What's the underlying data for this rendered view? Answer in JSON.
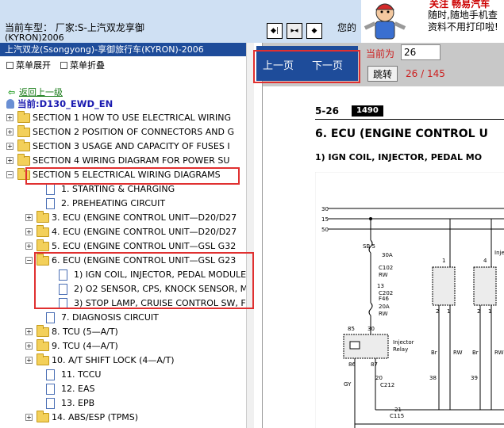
{
  "header": {
    "current_car_label": "当前车型：",
    "current_car_value": "厂家:S-上汽双龙享御",
    "current_car_model": "(KYRON)2006",
    "doc_hint": "您的",
    "ad": {
      "line1": "关注  畅易汽车",
      "line2": "随时,随地手机查",
      "line3": "资料不用打印啦!"
    },
    "nav_icons": [
      "first-page-icon",
      "fit-page-icon",
      "prev-frame-icon"
    ]
  },
  "left_panel": {
    "title": "上汽双龙(Ssongyong)-享御旅行车(KYRON)-2006",
    "expand_all": "菜单展开",
    "collapse_all": "菜单折叠",
    "back_link": "返回上一级",
    "current": "当前:D130_EWD_EN",
    "tree": [
      {
        "label": "SECTION 1 HOW TO USE ELECTRICAL WIRING",
        "type": "folder",
        "toggle": "+",
        "indent": 0
      },
      {
        "label": "SECTION 2 POSITION OF CONNECTORS AND G",
        "type": "folder",
        "toggle": "+",
        "indent": 0
      },
      {
        "label": "SECTION 3 USAGE AND CAPACITY OF FUSES I",
        "type": "folder",
        "toggle": "+",
        "indent": 0
      },
      {
        "label": "SECTION 4 WIRING DIAGRAM FOR POWER SU",
        "type": "folder",
        "toggle": "+",
        "indent": 0
      },
      {
        "label": "SECTION 5 ELECTRICAL WIRING DIAGRAMS",
        "type": "folder",
        "toggle": "−",
        "indent": 0
      },
      {
        "label": "1. STARTING & CHARGING",
        "type": "doc",
        "toggle": "",
        "indent": 1
      },
      {
        "label": "2. PREHEATING CIRCUIT",
        "type": "doc",
        "toggle": "",
        "indent": 1
      },
      {
        "label": "3. ECU (ENGINE CONTROL UNIT—D20/D27",
        "type": "folder",
        "toggle": "+",
        "indent": 1
      },
      {
        "label": "4. ECU (ENGINE CONTROL UNIT—D20/D27",
        "type": "folder",
        "toggle": "+",
        "indent": 1
      },
      {
        "label": "5. ECU (ENGINE CONTROL UNIT—GSL G32",
        "type": "folder",
        "toggle": "+",
        "indent": 1
      },
      {
        "label": "6. ECU (ENGINE CONTROL UNIT—GSL G23",
        "type": "folder",
        "toggle": "−",
        "indent": 1
      },
      {
        "label": "1) IGN COIL, INJECTOR, PEDAL MODULE",
        "type": "doc",
        "toggle": "",
        "indent": 2
      },
      {
        "label": "2) O2 SENSOR, CPS, KNOCK SENSOR, M",
        "type": "doc",
        "toggle": "",
        "indent": 2
      },
      {
        "label": "3) STOP LAMP, CRUISE CONTROL SW, F",
        "type": "doc",
        "toggle": "",
        "indent": 2
      },
      {
        "label": "7. DIAGNOSIS CIRCUIT",
        "type": "doc",
        "toggle": "",
        "indent": 1
      },
      {
        "label": "8. TCU (5—A/T)",
        "type": "folder",
        "toggle": "+",
        "indent": 1
      },
      {
        "label": "9. TCU (4—A/T)",
        "type": "folder",
        "toggle": "+",
        "indent": 1
      },
      {
        "label": "10. A/T SHIFT LOCK (4—A/T)",
        "type": "folder",
        "toggle": "+",
        "indent": 1
      },
      {
        "label": "11. TCCU",
        "type": "doc",
        "toggle": "",
        "indent": 1
      },
      {
        "label": "12. EAS",
        "type": "doc",
        "toggle": "",
        "indent": 1
      },
      {
        "label": "13. EPB",
        "type": "doc",
        "toggle": "",
        "indent": 1
      },
      {
        "label": "14. ABS/ESP (TPMS)",
        "type": "folder",
        "toggle": "+",
        "indent": 1
      }
    ]
  },
  "right_panel": {
    "prev_page": "上一页",
    "next_page": "下一页",
    "current_page_label": "当前为",
    "current_page_value": "26",
    "goto_button": "跳转",
    "page_count": "26 / 145",
    "doc": {
      "page_number": "5-26",
      "badge": "1490",
      "title": "6. ECU (ENGINE CONTROL U",
      "subtitle": "1)  IGN COIL, INJECTOR, PEDAL MO",
      "labels": {
        "bus30": "30",
        "bus15": "15",
        "bus50": "50",
        "fuse": "SB 5",
        "fuse_amp": "30A",
        "c102": "C102",
        "rw1": "RW",
        "n13": "13",
        "c202": "C202",
        "f46": "F46",
        "a20": "20A",
        "rw2": "RW",
        "n85": "85",
        "n30": "30",
        "n86": "86",
        "n87": "87",
        "relay1": "Injector",
        "relay2": "Relay",
        "n20": "20",
        "c212": "C212",
        "gy": "GY",
        "c115": "C115",
        "inj": "Inje",
        "p1": "1",
        "p4": "4",
        "p2": "2",
        "p1b": "1",
        "p2b": "2",
        "p1c": "1",
        "br1": "Br",
        "rw3": "RW",
        "br2": "Br",
        "rw4": "RW",
        "n38": "38",
        "n39": "39",
        "n21": "21"
      }
    }
  },
  "colors": {
    "header_bg": "#cfe0f3",
    "title_bar": "#1e4c9a",
    "highlight": "#e03030",
    "page_text": "#cc2020",
    "link_green": "#157a15"
  }
}
